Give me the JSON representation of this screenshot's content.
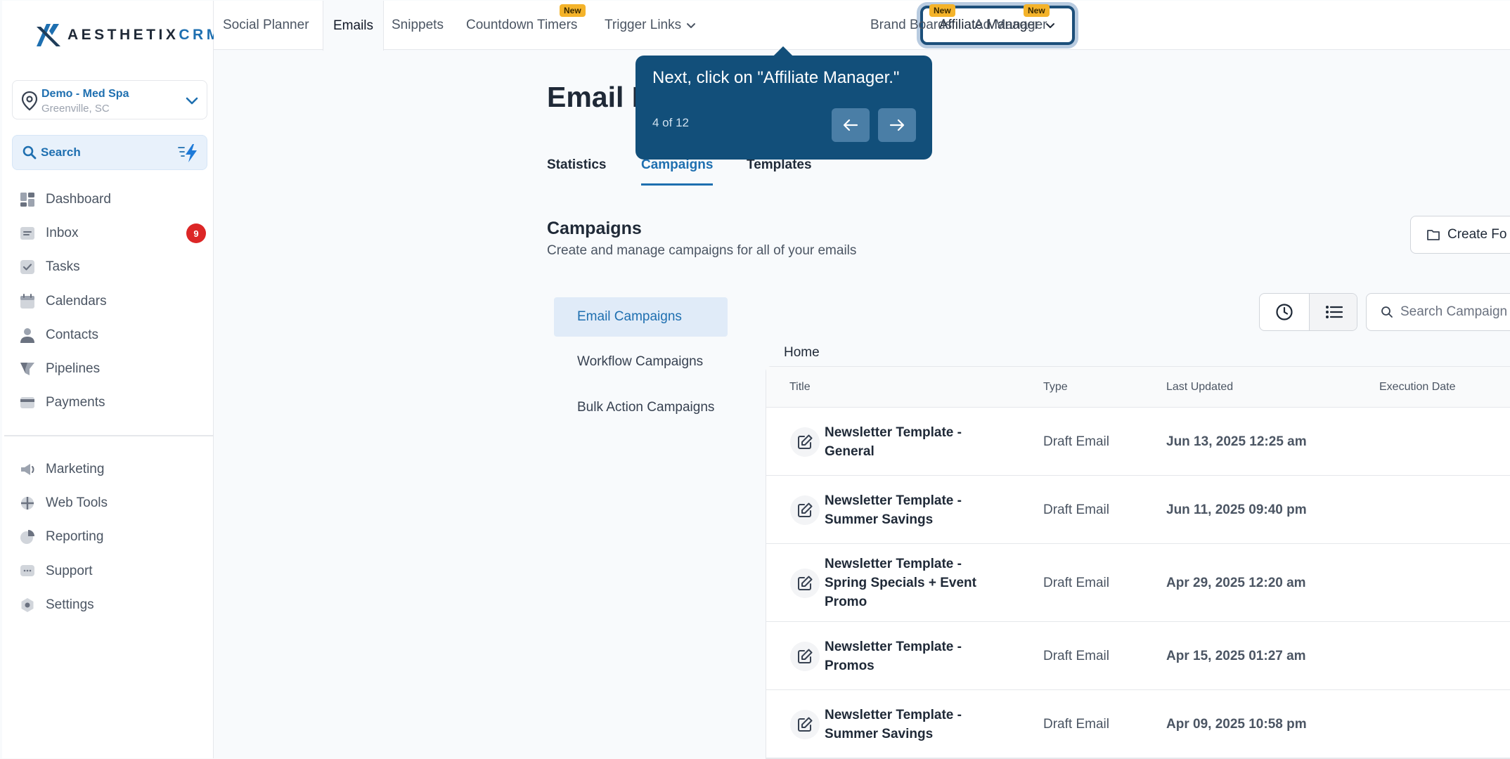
{
  "brand": {
    "name_left": "AESTHETIX",
    "name_right": "CRM"
  },
  "location": {
    "name": "Demo - Med Spa",
    "city": "Greenville, SC"
  },
  "sidebar": {
    "search_label": "Search",
    "items": [
      {
        "label": "Dashboard",
        "icon": "dashboard-icon"
      },
      {
        "label": "Inbox",
        "icon": "inbox-icon",
        "badge": "9"
      },
      {
        "label": "Tasks",
        "icon": "tasks-icon"
      },
      {
        "label": "Calendars",
        "icon": "calendar-icon"
      },
      {
        "label": "Contacts",
        "icon": "contacts-icon"
      },
      {
        "label": "Pipelines",
        "icon": "pipelines-icon"
      },
      {
        "label": "Payments",
        "icon": "payments-icon"
      }
    ],
    "items2": [
      {
        "label": "Marketing",
        "icon": "marketing-icon"
      },
      {
        "label": "Web Tools",
        "icon": "web-tools-icon"
      },
      {
        "label": "Reporting",
        "icon": "reporting-icon"
      },
      {
        "label": "Support",
        "icon": "support-icon"
      },
      {
        "label": "Settings",
        "icon": "settings-icon"
      }
    ]
  },
  "topnav": {
    "tabs": [
      "Social Planner",
      "Emails",
      "Snippets",
      "Countdown Timers",
      "Trigger Links",
      "Affiliate Manager",
      "Brand Boards",
      "Ad Manager"
    ],
    "new_badge": "New",
    "active": "Emails",
    "highlighted": "Affiliate Manager"
  },
  "tooltip": {
    "text": "Next, click on \"Affiliate Manager.\"",
    "step": "4 of 12"
  },
  "main": {
    "title": "Email M",
    "subtabs": [
      "Statistics",
      "Campaigns",
      "Templates"
    ],
    "active_subtab": "Campaigns",
    "section_title": "Campaigns",
    "section_sub": "Create and manage campaigns for all of your emails",
    "create_button": "Create Fo",
    "search_placeholder": "Search Campaign",
    "breadcrumb": "Home",
    "left_menu": [
      "Email Campaigns",
      "Workflow Campaigns",
      "Bulk Action Campaigns"
    ],
    "columns": [
      "Title",
      "Type",
      "Last Updated",
      "Execution Date"
    ],
    "rows": [
      {
        "title1": "Newsletter Template -",
        "title2": "General",
        "title3": "",
        "type": "Draft Email",
        "updated": "Jun 13, 2025 12:25 am"
      },
      {
        "title1": "Newsletter Template -",
        "title2": "Summer Savings",
        "title3": "",
        "type": "Draft Email",
        "updated": "Jun 11, 2025 09:40 pm"
      },
      {
        "title1": "Newsletter Template -",
        "title2": "Spring Specials + Event",
        "title3": "Promo",
        "type": "Draft Email",
        "updated": "Apr 29, 2025 12:20 am"
      },
      {
        "title1": "Newsletter Template -",
        "title2": "Promos",
        "title3": "",
        "type": "Draft Email",
        "updated": "Apr 15, 2025 01:27 am"
      },
      {
        "title1": "Newsletter Template -",
        "title2": "Summer Savings",
        "title3": "",
        "type": "Draft Email",
        "updated": "Apr 09, 2025 10:58 pm"
      }
    ]
  }
}
